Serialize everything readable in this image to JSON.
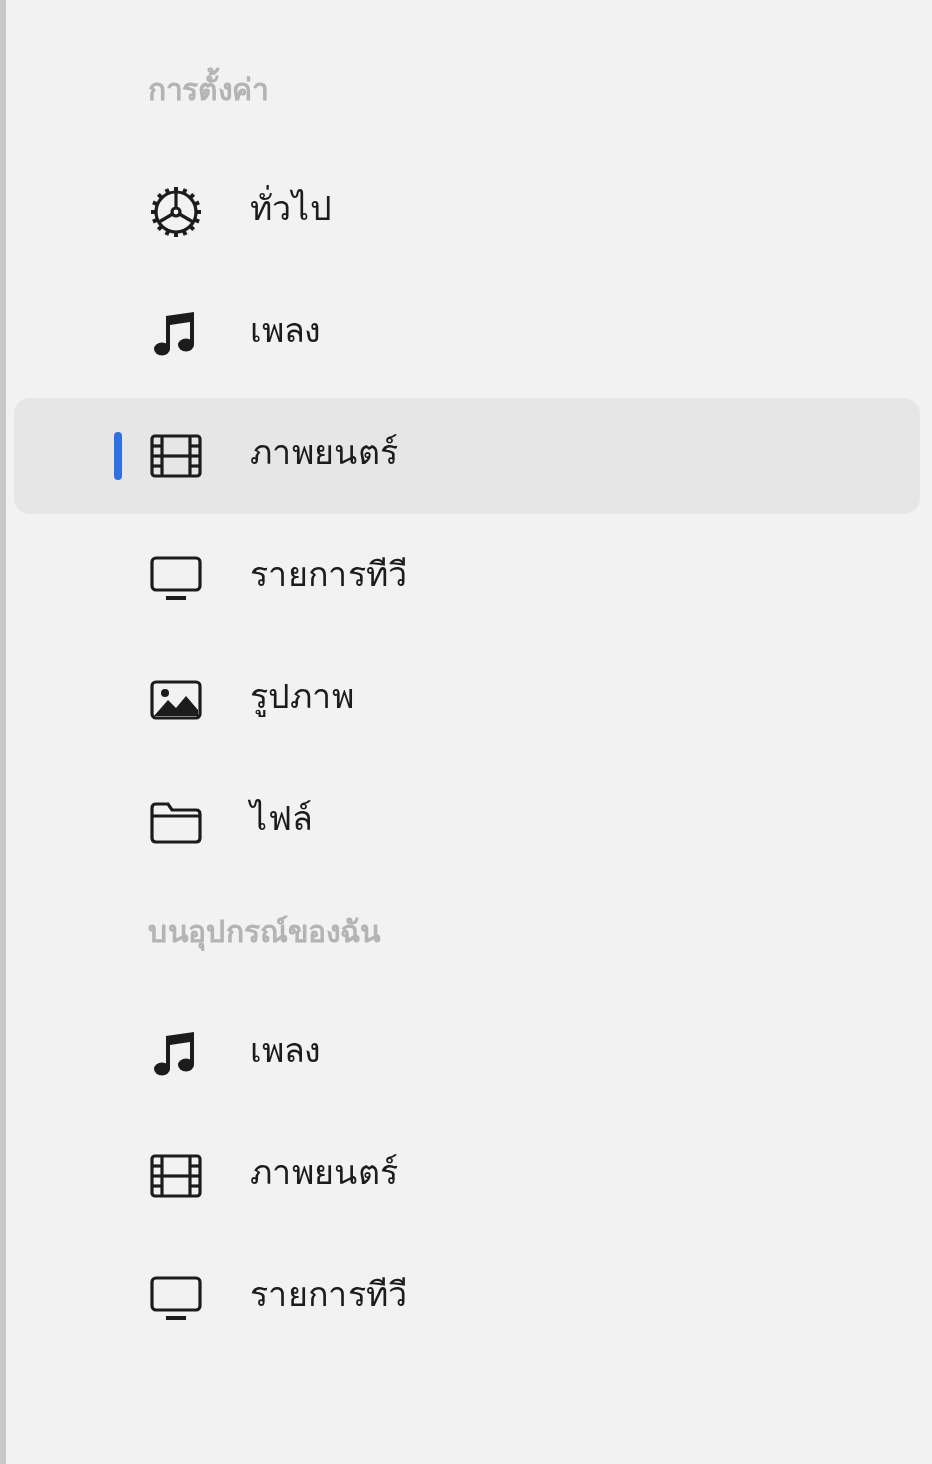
{
  "sections": [
    {
      "title": "การตั้งค่า",
      "items": [
        {
          "label": "ทั่วไป",
          "kind": "general",
          "selected": false
        },
        {
          "label": "เพลง",
          "kind": "music",
          "selected": false
        },
        {
          "label": "ภาพยนตร์",
          "kind": "movies",
          "selected": true
        },
        {
          "label": "รายการทีวี",
          "kind": "tv",
          "selected": false
        },
        {
          "label": "รูปภาพ",
          "kind": "photos",
          "selected": false
        },
        {
          "label": "ไฟล์",
          "kind": "files",
          "selected": false
        }
      ]
    },
    {
      "title": "บนอุปกรณ์ของฉัน",
      "items": [
        {
          "label": "เพลง",
          "kind": "music",
          "selected": false
        },
        {
          "label": "ภาพยนตร์",
          "kind": "movies",
          "selected": false
        },
        {
          "label": "รายการทีวี",
          "kind": "tv",
          "selected": false
        }
      ]
    }
  ]
}
